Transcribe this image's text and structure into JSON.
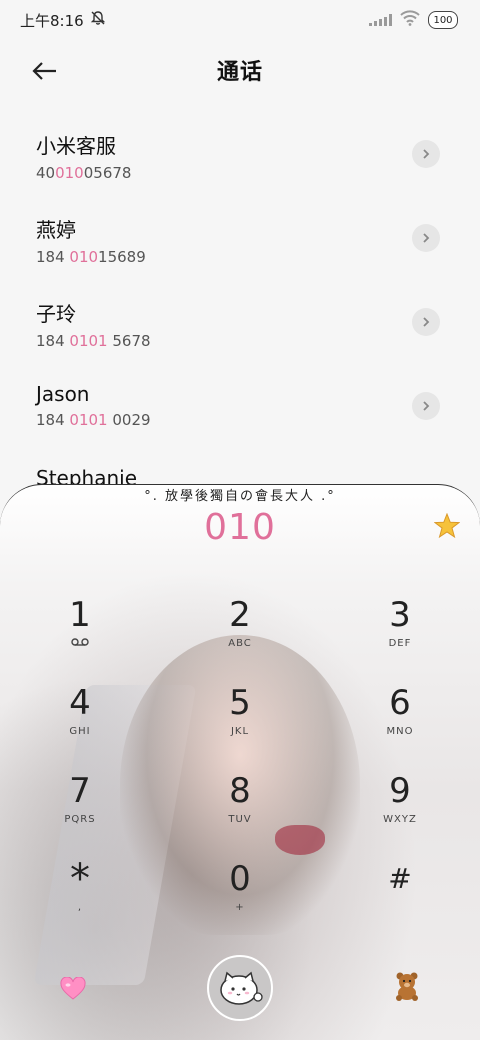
{
  "status_bar": {
    "time": "上午8:16",
    "battery": "100"
  },
  "header": {
    "title": "通话"
  },
  "contacts": [
    {
      "name": "小米客服",
      "number_pre": "40",
      "number_match": "010",
      "number_post": "05678"
    },
    {
      "name": "燕婷",
      "number_pre": "184 ",
      "number_match": "010",
      "number_post": "15689"
    },
    {
      "name": "子玲",
      "number_pre": "184 ",
      "number_match": "0101",
      "number_post": " 5678"
    },
    {
      "name": "Jason",
      "number_pre": "184 ",
      "number_match": "0101",
      "number_post": " 0029"
    },
    {
      "name": "Stephanie",
      "number_pre": "",
      "number_match": "",
      "number_post": ""
    }
  ],
  "dialer": {
    "caption": "°. 放學後獨自の會長大人 .°",
    "dialed_number": "010",
    "keys": [
      [
        {
          "digit": "1",
          "sub": "voicemail-icon"
        },
        {
          "digit": "2",
          "sub": "ABC"
        },
        {
          "digit": "3",
          "sub": "DEF"
        }
      ],
      [
        {
          "digit": "4",
          "sub": "GHI"
        },
        {
          "digit": "5",
          "sub": "JKL"
        },
        {
          "digit": "6",
          "sub": "MNO"
        }
      ],
      [
        {
          "digit": "7",
          "sub": "PQRS"
        },
        {
          "digit": "8",
          "sub": "TUV"
        },
        {
          "digit": "9",
          "sub": "WXYZ"
        }
      ],
      [
        {
          "digit": "*",
          "sub": ","
        },
        {
          "digit": "0",
          "sub": "+"
        },
        {
          "digit": "#",
          "sub": ""
        }
      ]
    ]
  },
  "colors": {
    "highlight": "#e0709a",
    "star": "#f6c23a",
    "heart": "#ff8fc4"
  }
}
